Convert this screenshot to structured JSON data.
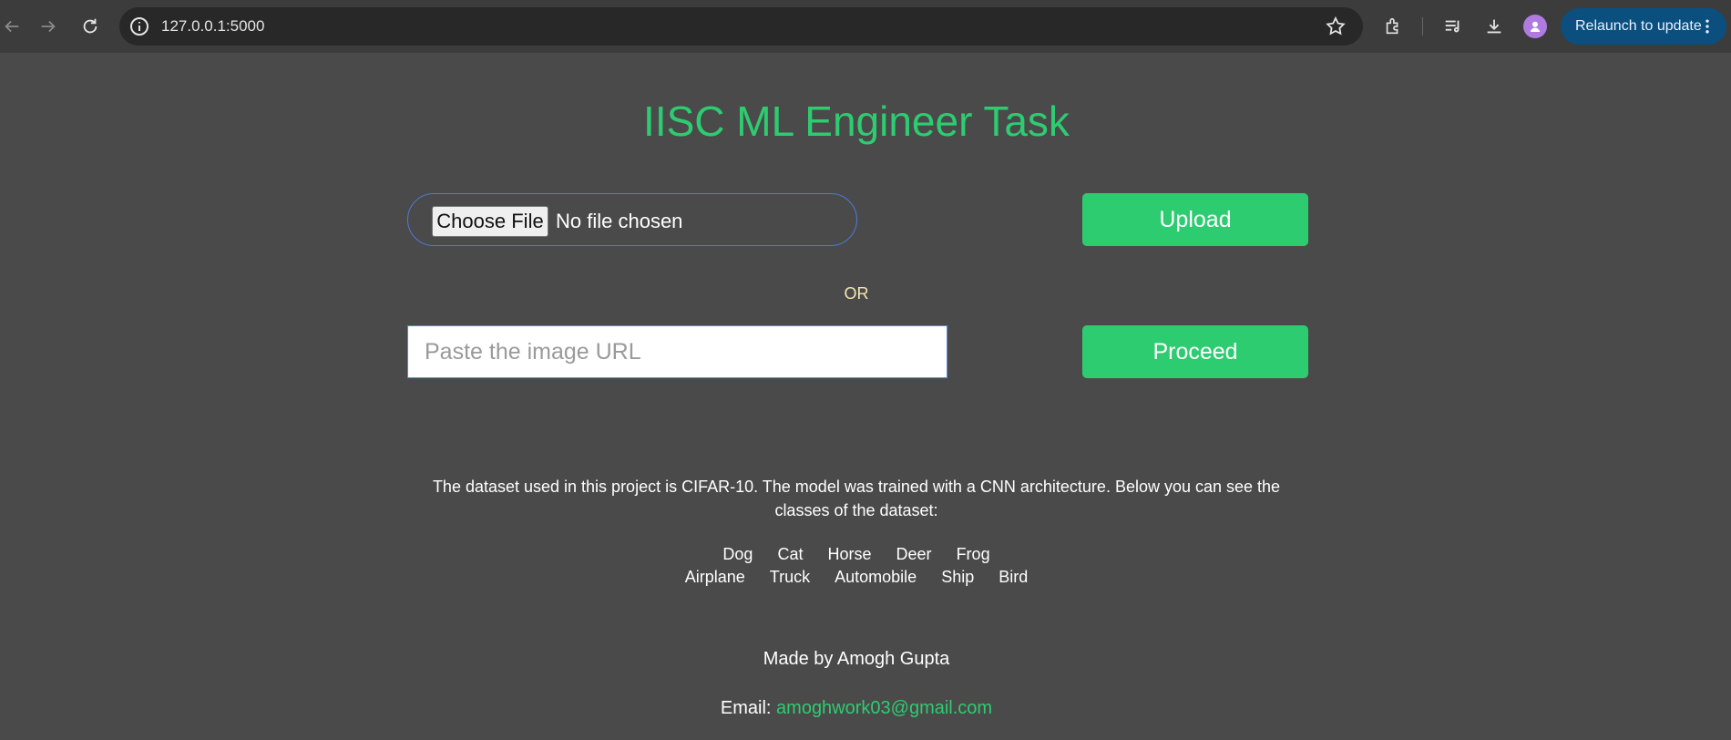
{
  "browser": {
    "url": "127.0.0.1:5000",
    "relaunch_label": "Relaunch to update",
    "icons": [
      "back-arrow-icon",
      "forward-arrow-icon",
      "reload-icon",
      "site-info-icon",
      "bookmark-star-icon",
      "extensions-icon",
      "reading-list-icon",
      "download-icon",
      "profile-avatar",
      "more-vertical-icon"
    ]
  },
  "page": {
    "title": "IISC ML Engineer Task",
    "file_input": {
      "button_label": "Choose File",
      "status": "No file chosen"
    },
    "upload_label": "Upload",
    "or_label": "OR",
    "url_input": {
      "placeholder": "Paste the image URL"
    },
    "proceed_label": "Proceed",
    "description": "The dataset used in this project is CIFAR-10. The model was trained with a CNN architecture. Below you can see the classes of the dataset:",
    "classes_row1": [
      "Dog",
      "Cat",
      "Horse",
      "Deer",
      "Frog"
    ],
    "classes_row2": [
      "Airplane",
      "Truck",
      "Automobile",
      "Ship",
      "Bird"
    ],
    "made_by": "Made by Amogh Gupta",
    "email_label": "Email:",
    "email": "amoghwork03@gmail.com"
  },
  "colors": {
    "accent": "#2ecc71",
    "background": "#4a4a4a",
    "or_text": "#f3e7b0"
  }
}
